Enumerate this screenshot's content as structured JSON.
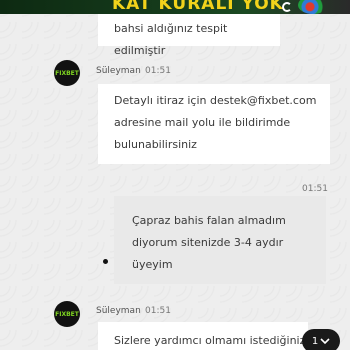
{
  "banner": {
    "text": "KAT KURALI YOK"
  },
  "messages": [
    {
      "text": "bahsi aldığınız tespit edilmiştir"
    },
    {
      "sender": "Süleyman",
      "time": "01:51",
      "avatar_text": "FIXBET",
      "lines": [
        "Detaylı itiraz için destek@fixbet.com",
        "adresine mail yolu ile bildirimde",
        "bulunabilirsiniz"
      ]
    },
    {
      "time": "01:51",
      "lines": [
        "Çapraz bahis falan almadım",
        "diyorum sitenizde 3-4 aydır",
        "üyeyim"
      ]
    },
    {
      "sender": "Süleyman",
      "time": "01:51",
      "avatar_text": "FIXBET",
      "text": "Sizlere yardımcı olmamı istediğiniz"
    }
  ],
  "unread": {
    "count": "1",
    "icon": "chevron-down-icon"
  },
  "colors": {
    "banner_text": "#f2d21b",
    "agent_bubble": "#ffffff",
    "user_bubble": "#e9e9e9",
    "logo_green": "#7ed321"
  }
}
